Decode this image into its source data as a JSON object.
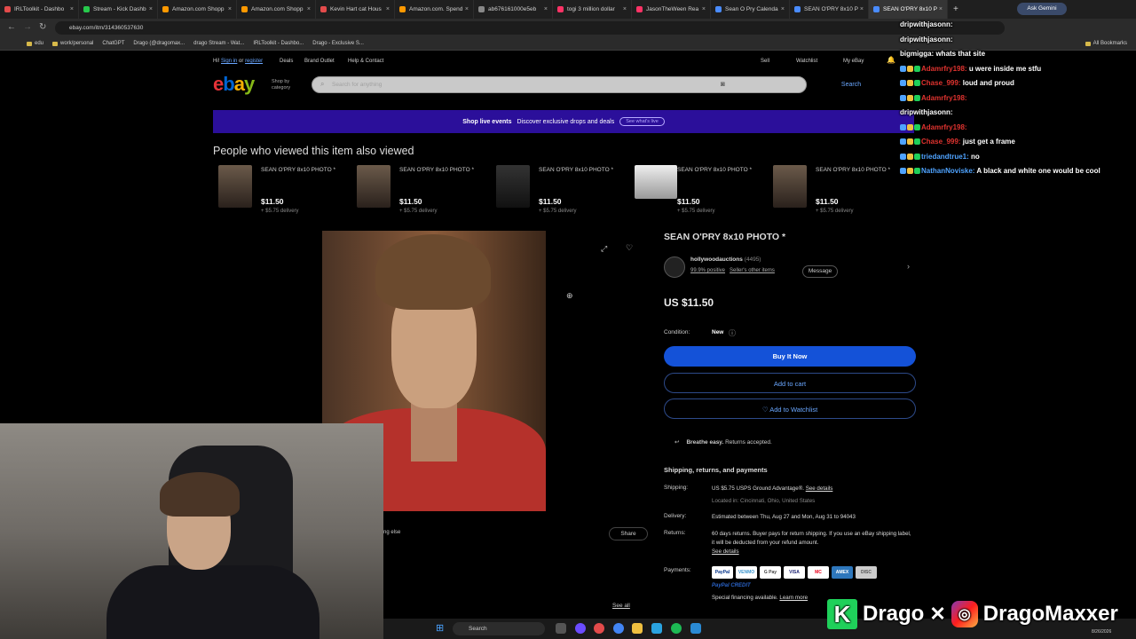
{
  "browser": {
    "tabs": [
      {
        "label": "IRLToolkit - Dashbo",
        "color": "#e34b4b"
      },
      {
        "label": "Stream - Kick Dashb",
        "color": "#27c94c"
      },
      {
        "label": "Amazon.com Shopp",
        "color": "#ff9900"
      },
      {
        "label": "Amazon.com Shopp",
        "color": "#ff9900"
      },
      {
        "label": "Kevin Hart cat Hous",
        "color": "#e34b4b"
      },
      {
        "label": "Amazon.com. Spend",
        "color": "#ff9900"
      },
      {
        "label": "ab676161000e5eb",
        "color": "#888888"
      },
      {
        "label": "togi 3 million dollar",
        "color": "#ff3366"
      },
      {
        "label": "JasonTheWeen Rea",
        "color": "#ff3366"
      },
      {
        "label": "Sean O Pry Calenda",
        "color": "#4a8cff"
      },
      {
        "label": "SEAN O'PRY 8x10 P",
        "color": "#4a8cff"
      },
      {
        "label": "SEAN O'PRY 8x10 P",
        "color": "#4a8cff",
        "active": true
      }
    ],
    "ask_gemini": "Ask Gemini",
    "url": "ebay.com/itm/314360537630",
    "bookmarks": [
      "edu",
      "work/personal",
      "ChatGPT",
      "Drago (@dragomax...",
      "drago Stream - Wat...",
      "IRLToolkit - Dashbo...",
      "Drago - Exclusive S..."
    ],
    "all_bookmarks": "All Bookmarks"
  },
  "ebay": {
    "topnav": {
      "greeting": "Hi!",
      "sign_in": "Sign in",
      "or": "or",
      "register": "register",
      "deals": "Deals",
      "brand_outlet": "Brand Outlet",
      "help": "Help & Contact",
      "sell": "Sell",
      "watchlist": "Watchlist",
      "my_ebay": "My eBay"
    },
    "logo": "ebay",
    "shop_by_category": "Shop by category",
    "search_placeholder": "Search for anything",
    "search_button": "Search",
    "banner": {
      "title": "Shop live events",
      "text": "Discover exclusive drops and deals",
      "cta": "See what's live"
    },
    "also_viewed_title": "People who viewed this item also viewed",
    "also_viewed": [
      {
        "title": "SEAN O'PRY 8x10 PHOTO *",
        "price": "$11.50",
        "delivery": "+ $5.75 delivery"
      },
      {
        "title": "SEAN O'PRY 8x10 PHOTO *",
        "price": "$11.50",
        "delivery": "+ $5.75 delivery"
      },
      {
        "title": "SEAN O'PRY 8x10 PHOTO *",
        "price": "$11.50",
        "delivery": "+ $5.75 delivery"
      },
      {
        "title": "SEAN O'PRY 8x10 PHOTO *",
        "price": "$11.50",
        "delivery": "+ $5.75 delivery"
      },
      {
        "title": "SEAN O'PRY 8x10 PHOTO *",
        "price": "$11.50",
        "delivery": "+ $5.75 delivery"
      }
    ],
    "item": {
      "title": "SEAN O'PRY 8x10 PHOTO *",
      "seller_name": "hollywoodauctions",
      "seller_count": "(4495)",
      "seller_positive": "99.9% positive",
      "seller_other": "Seller's other items",
      "message": "Message",
      "price": "US $11.50",
      "condition_label": "Condition:",
      "condition_value": "New",
      "buy_now": "Buy It Now",
      "add_to_cart": "Add to cart",
      "add_to_watchlist": "♡ Add to Watchlist",
      "breathe_easy": "Breathe easy.",
      "returns_accepted": "Returns accepted.",
      "shipping_heading": "Shipping, returns, and payments",
      "shipping_label": "Shipping:",
      "shipping_value": "US $5.75 USPS Ground Advantage®.",
      "see_details": "See details",
      "located": "Located in: Cincinnati, Ohio, United States",
      "delivery_label": "Delivery:",
      "delivery_value": "Estimated between Thu, Aug 27 and Mon, Aug 31 to 94043",
      "returns_label": "Returns:",
      "returns_value": "60 days returns. Buyer pays for return shipping. If you use an eBay shipping label, it will be deducted from your refund amount.",
      "returns_see_details": "See details",
      "payments_label": "Payments:",
      "payments": [
        "PayPal",
        "VENMO",
        "G Pay",
        "VISA",
        "MC",
        "AMEX",
        "DISC"
      ],
      "paypal_credit": "PayPal CREDIT",
      "financing": "Special financing available.",
      "learn_more": "Learn more",
      "share": "Share",
      "someone_else": "ng else",
      "see_all": "See all"
    }
  },
  "chat": [
    {
      "user": "dripwithjasonn:",
      "text": "",
      "ucolor": "white"
    },
    {
      "user": "dripwithjasonn:",
      "text": "",
      "ucolor": "white"
    },
    {
      "user": "bigmigga:",
      "text": "whats that site",
      "ucolor": "white"
    },
    {
      "user": "Adamrfry198:",
      "text": "u were inside me stfu",
      "ucolor": "red"
    },
    {
      "user": "Chase_999:",
      "text": "loud and proud",
      "ucolor": "red"
    },
    {
      "user": "Adamrfry198:",
      "text": "",
      "ucolor": "red"
    },
    {
      "user": "dripwithjasonn:",
      "text": "",
      "ucolor": "white"
    },
    {
      "user": "Adamrfry198:",
      "text": "",
      "ucolor": "red"
    },
    {
      "user": "Chase_999:",
      "text": "just get a frame",
      "ucolor": "red"
    },
    {
      "user": "triedandtrue1:",
      "text": "no",
      "ucolor": "blue"
    },
    {
      "user": "NathanNoviske:",
      "text": "A black and white one would be cool",
      "ucolor": "blue"
    }
  ],
  "taskbar": {
    "search": "Search",
    "date": "8/26/2026"
  },
  "brand_overlay": {
    "name1": "Drago",
    "name2": "DragoMaxxer"
  }
}
